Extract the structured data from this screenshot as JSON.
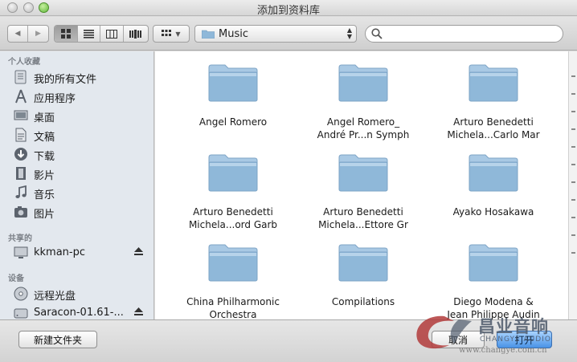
{
  "window": {
    "title": "添加到资料库"
  },
  "toolbar": {
    "nav": [
      "◀",
      "▶"
    ],
    "views": [
      "icon-view",
      "list-view",
      "column-view",
      "coverflow-view"
    ],
    "arrange_icon": "arrange-icon",
    "path_label": "Music",
    "search_placeholder": ""
  },
  "sidebar": {
    "sections": [
      {
        "title": "个人收藏",
        "items": [
          {
            "label": "我的所有文件",
            "icon": "all-files-icon"
          },
          {
            "label": "应用程序",
            "icon": "applications-icon"
          },
          {
            "label": "桌面",
            "icon": "desktop-icon"
          },
          {
            "label": "文稿",
            "icon": "documents-icon"
          },
          {
            "label": "下载",
            "icon": "downloads-icon"
          },
          {
            "label": "影片",
            "icon": "movies-icon"
          },
          {
            "label": "音乐",
            "icon": "music-icon"
          },
          {
            "label": "图片",
            "icon": "pictures-icon"
          }
        ]
      },
      {
        "title": "共享的",
        "items": [
          {
            "label": "kkman-pc",
            "icon": "pc-icon",
            "eject": true
          }
        ]
      },
      {
        "title": "设备",
        "items": [
          {
            "label": "远程光盘",
            "icon": "remote-disc-icon"
          },
          {
            "label": "Saracon-01.61-...",
            "icon": "disk-icon",
            "eject": true
          }
        ]
      }
    ]
  },
  "files": [
    {
      "name": [
        "Angel Romero"
      ]
    },
    {
      "name": [
        "Angel Romero_",
        "André Pr...n Symph"
      ]
    },
    {
      "name": [
        "Arturo Benedetti",
        "Michela...Carlo Mar"
      ]
    },
    {
      "name": [
        "Arturo Benedetti",
        "Michela...ord Garb"
      ]
    },
    {
      "name": [
        "Arturo Benedetti",
        "Michela...Ettore Gr"
      ]
    },
    {
      "name": [
        "Ayako Hosakawa"
      ]
    },
    {
      "name": [
        "China Philharmonic",
        "Orchestra"
      ]
    },
    {
      "name": [
        "Compilations"
      ]
    },
    {
      "name": [
        "Diego Modena &",
        "Jean Philippe Audin"
      ]
    }
  ],
  "bottom": {
    "new_folder": "新建文件夹",
    "cancel": "取消",
    "open": "打开"
  },
  "watermark": {
    "cn": "昌业音响",
    "en": "CHANGYE AUDIO",
    "url": "www.changye.com.cn"
  },
  "colors": {
    "folder": "#8fb8d9",
    "accent": "#4a93e6"
  }
}
